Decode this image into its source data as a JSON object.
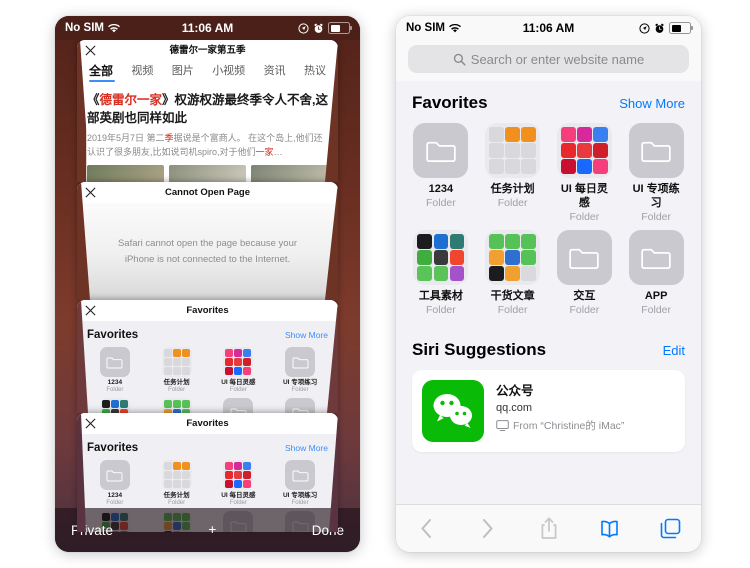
{
  "left_phone": {
    "status_bar": {
      "carrier": "No SIM",
      "wifi_icon": "wifi-icon",
      "time": "11:06 AM",
      "location_icon": "location-arrow-icon",
      "alarm_icon": "alarm-clock-icon",
      "battery_icon": "battery-icon"
    },
    "background_color": "#6a2f22",
    "cards": [
      {
        "close_icon": "close-icon",
        "title": "德雷尔一家第五季",
        "tabs": [
          {
            "label": "全部",
            "active": true
          },
          {
            "label": "视频",
            "active": false
          },
          {
            "label": "图片",
            "active": false
          },
          {
            "label": "小视频",
            "active": false
          },
          {
            "label": "资讯",
            "active": false
          },
          {
            "label": "热议",
            "active": false
          }
        ],
        "headline_pre": "《",
        "headline_hl": "德雷尔一家",
        "headline_post": "》权游权游最终季令人不舍,这部英剧也同样如此",
        "snippet_pre": "2019年5月7日 第二",
        "snippet_hl": "季",
        "snippet_post": "据说是个富商人。 在这个岛上,他们还认识了很多朋友,比如说司机spiro,对于他们",
        "snippet_hl2": "一家",
        "snippet_tail": "…"
      },
      {
        "close_icon": "close-icon",
        "title": "Cannot Open Page",
        "message": "Safari cannot open the page because your iPhone is not connected to the Internet."
      },
      {
        "close_icon": "close-icon",
        "title": "Favorites",
        "section_title": "Favorites",
        "show_more": "Show More"
      },
      {
        "close_icon": "close-icon",
        "title": "Favorites",
        "section_title": "Favorites",
        "show_more": "Show More"
      }
    ],
    "toolbar": {
      "private_label": "Private",
      "add_icon": "plus-icon",
      "done_label": "Done"
    }
  },
  "right_phone": {
    "status_bar": {
      "carrier": "No SIM",
      "wifi_icon": "wifi-icon",
      "time": "11:06 AM",
      "location_icon": "location-arrow-icon",
      "alarm_icon": "alarm-clock-icon",
      "battery_icon": "battery-icon"
    },
    "search": {
      "icon": "search-icon",
      "placeholder": "Search or enter website name",
      "value": ""
    },
    "favorites": {
      "title": "Favorites",
      "show_more": "Show More"
    },
    "siri": {
      "title": "Siri Suggestions",
      "edit": "Edit",
      "card": {
        "app_icon": "wechat-icon",
        "name": "公众号",
        "url": "qq.com",
        "device_icon": "display-icon",
        "from": "From “Christine的 iMac”"
      }
    },
    "toolbar": {
      "back_icon": "chevron-left-icon",
      "forward_icon": "chevron-right-icon",
      "share_icon": "share-icon",
      "bookmarks_icon": "book-icon",
      "tabs_icon": "tabs-icon",
      "accent_color": "#007aff"
    }
  },
  "favorites_items": [
    {
      "name": "1234",
      "sub": "Folder",
      "icon": "folder-icon",
      "tiles": []
    },
    {
      "name": "任务计划",
      "sub": "Folder",
      "icon": "tiles-icon",
      "tiles": [
        "#d8d8dd",
        "#f0901f",
        "#f0901f",
        "#d8d8dd",
        "#d8d8dd",
        "#d8d8dd",
        "#d8d8dd",
        "#d8d8dd",
        "#d8d8dd"
      ]
    },
    {
      "name": "UI 每日灵感",
      "sub": "Folder",
      "icon": "tiles-icon",
      "tiles": [
        "#f43f7a",
        "#d6299a",
        "#3b7ef0",
        "#e8282c",
        "#e8393f",
        "#cf1f2b",
        "#c8102e",
        "#1769ff",
        "#f43f7a"
      ]
    },
    {
      "name": "UI 专项练习",
      "sub": "Folder",
      "icon": "folder-icon",
      "tiles": []
    },
    {
      "name": "工具素材",
      "sub": "Folder",
      "icon": "tiles-icon",
      "tiles": [
        "#1c1c1e",
        "#1f6fd0",
        "#2f7a73",
        "#3fae3f",
        "#3a3a3c",
        "#f0452f",
        "#5ac35a",
        "#5ac35a",
        "#a352c9"
      ]
    },
    {
      "name": "干货文章",
      "sub": "Folder",
      "icon": "tiles-icon",
      "tiles": [
        "#56c156",
        "#56c156",
        "#56c156",
        "#f0a030",
        "#2f6fd0",
        "#56c156",
        "#1c1c1e",
        "#f0a030",
        "#d9d9de"
      ]
    },
    {
      "name": "交互",
      "sub": "Folder",
      "icon": "folder-icon",
      "tiles": []
    },
    {
      "name": "APP",
      "sub": "Folder",
      "icon": "folder-icon",
      "tiles": []
    }
  ]
}
